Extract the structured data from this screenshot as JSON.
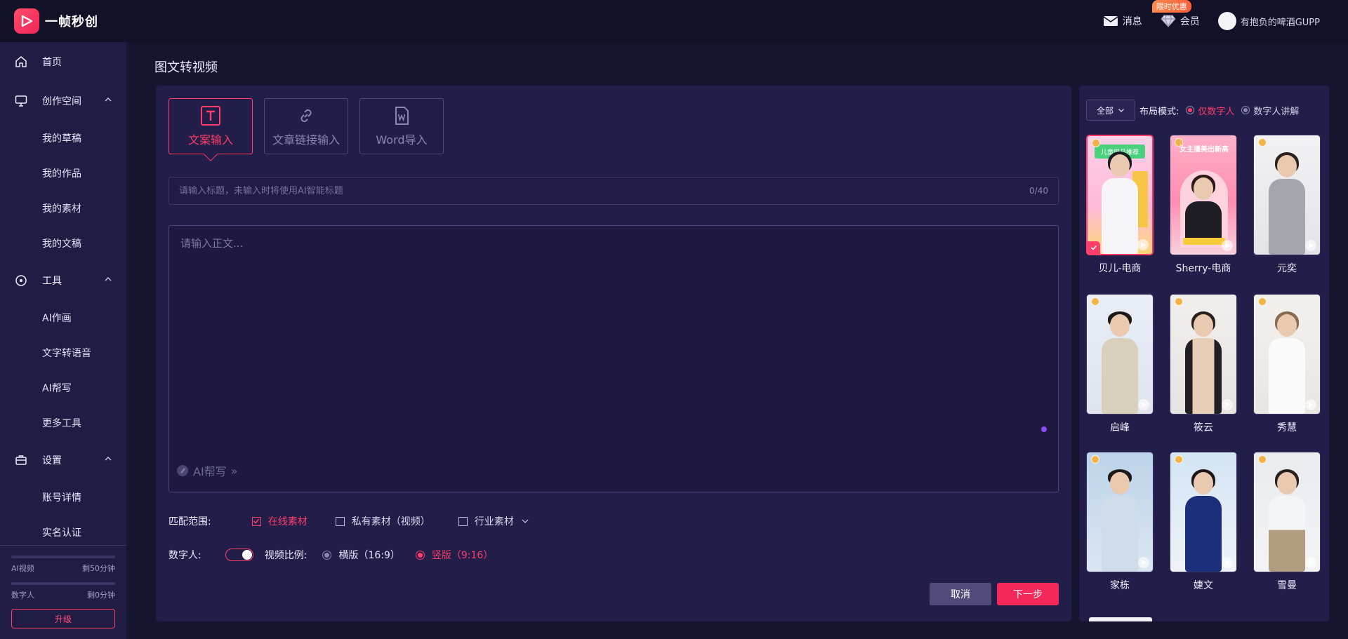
{
  "header": {
    "app_name": "一帧秒创",
    "messages_label": "消息",
    "member_label": "会员",
    "promo_badge": "限时优惠",
    "username": "有抱负的啤酒GUPP"
  },
  "sidebar": {
    "home": "首页",
    "groups": [
      {
        "label": "创作空间",
        "items": [
          "我的草稿",
          "我的作品",
          "我的素材",
          "我的文稿"
        ]
      },
      {
        "label": "工具",
        "items": [
          "AI作画",
          "文字转语音",
          "AI帮写",
          "更多工具"
        ]
      },
      {
        "label": "设置",
        "items": [
          "账号详情",
          "实名认证"
        ]
      }
    ],
    "quota": {
      "video_label": "AI视频",
      "video_remaining": "剩50分钟",
      "human_label": "数字人",
      "human_remaining": "剩0分钟",
      "upgrade_label": "升级"
    }
  },
  "main": {
    "page_title": "图文转视频",
    "tabs": [
      "文案输入",
      "文章链接输入",
      "Word导入"
    ],
    "title_input": {
      "placeholder": "请输入标题，未输入时将使用AI智能标题",
      "value": "",
      "count": "0/40"
    },
    "body_input": {
      "placeholder": "请输入正文...",
      "value": ""
    },
    "ai_write_label": "AI帮写",
    "ai_write_arrow": "»",
    "match_scope": {
      "label": "匹配范围:",
      "options": [
        {
          "label": "在线素材",
          "checked": true
        },
        {
          "label": "私有素材（视频）",
          "checked": false
        },
        {
          "label": "行业素材",
          "checked": false
        }
      ]
    },
    "digital_human_label": "数字人:",
    "ratio": {
      "label": "视频比例:",
      "options": [
        {
          "label": "横版（16:9）",
          "selected": false
        },
        {
          "label": "竖版（9:16）",
          "selected": true
        }
      ]
    },
    "cancel_label": "取消",
    "next_label": "下一步"
  },
  "avatar_panel": {
    "filter_value": "全部",
    "layout_label": "布局模式:",
    "layout_options": [
      {
        "label": "仅数字人",
        "selected": true
      },
      {
        "label": "数字人讲解",
        "selected": false
      }
    ],
    "thumb_caption_1": "儿童用品推荐",
    "thumb_caption_2": "女主播美出新高",
    "avatars": [
      {
        "name": "贝儿-电商",
        "selected": true
      },
      {
        "name": "Sherry-电商",
        "selected": false
      },
      {
        "name": "元奕",
        "selected": false
      },
      {
        "name": "启峰",
        "selected": false
      },
      {
        "name": "筱云",
        "selected": false
      },
      {
        "name": "秀慧",
        "selected": false
      },
      {
        "name": "家栋",
        "selected": false
      },
      {
        "name": "婕文",
        "selected": false
      },
      {
        "name": "雪曼",
        "selected": false
      }
    ]
  },
  "colors": {
    "accent": "#ff3d6a",
    "background": "#171430",
    "panel": "#231d49",
    "sidebar": "#211c44"
  }
}
